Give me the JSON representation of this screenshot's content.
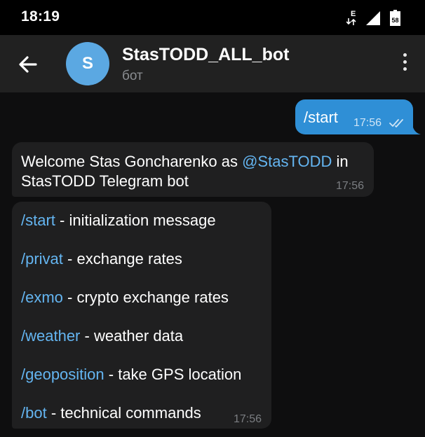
{
  "status_bar": {
    "time": "18:19",
    "network_label": "E",
    "battery_label": "58"
  },
  "header": {
    "back_icon": "arrow-left-icon",
    "avatar_letter": "S",
    "avatar_color": "#5ba8e2",
    "title": "StasTODD_ALL_bot",
    "subtitle": "бот",
    "menu_icon": "more-vertical-icon"
  },
  "messages": {
    "outgoing": {
      "text": "/start",
      "time": "17:56",
      "status_icon": "double-check-icon"
    },
    "welcome": {
      "prefix": "Welcome Stas Goncharenko as ",
      "mention": "@StasTODD",
      "suffix_line1": " in",
      "line2": "StasTODD Telegram bot",
      "time": "17:56"
    },
    "commands": {
      "items": [
        {
          "command": "/start",
          "description": " - initialization message"
        },
        {
          "command": "/privat",
          "description": " - exchange rates"
        },
        {
          "command": "/exmo",
          "description": " - crypto exchange rates"
        },
        {
          "command": "/weather",
          "description": " - weather data"
        },
        {
          "command": "/geoposition",
          "description": " - take GPS location"
        },
        {
          "command": "/bot",
          "description": " - technical commands"
        }
      ],
      "time": "17:56"
    }
  },
  "colors": {
    "outgoing_bubble": "#2f8fd6",
    "incoming_bubble": "#1f1f20",
    "link": "#64b5f1",
    "header_bg": "#212121"
  }
}
